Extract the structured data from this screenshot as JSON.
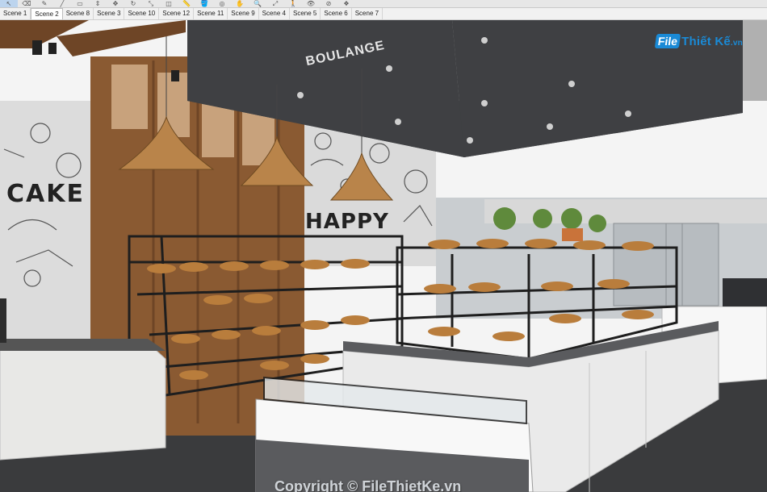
{
  "toolbar": {
    "icons": [
      "select-arrow-icon",
      "eraser-icon",
      "pencil-icon",
      "line-icon",
      "shape-icon",
      "push-pull-icon",
      "move-icon",
      "rotate-icon",
      "scale-icon",
      "offset-icon",
      "tape-icon",
      "paint-icon",
      "orbit-icon",
      "pan-icon",
      "zoom-icon",
      "zoom-extents-icon",
      "walk-icon",
      "look-icon",
      "section-icon",
      "component-icon"
    ]
  },
  "scenes": {
    "tabs": [
      "Scene 1",
      "Scene 2",
      "Scene 8",
      "Scene 3",
      "Scene 10",
      "Scene 12",
      "Scene 11",
      "Scene 9",
      "Scene 4",
      "Scene 5",
      "Scene 6",
      "Scene 7"
    ],
    "active_index": 1
  },
  "viewport": {
    "sign_text": "BOULANGE",
    "wall_words": [
      "CAKE",
      "HAPPY"
    ]
  },
  "watermark": {
    "logo_box": "File",
    "logo_text": "Thiết Kế",
    "logo_suffix": ".vn",
    "copyright": "Copyright © FileThietKe.vn"
  },
  "colors": {
    "ceiling": "#3f4043",
    "concrete": "#a9a9a9",
    "wood": "#8a5a32",
    "marble": "#e8e8e6",
    "floor": "#3a3b3d",
    "metal": "#1e1e1e"
  }
}
